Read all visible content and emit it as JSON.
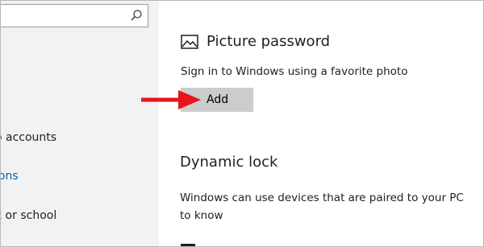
{
  "sidebar": {
    "search": {
      "value": "",
      "placeholder": ""
    },
    "items": [
      {
        "label": "o accounts"
      },
      {
        "label": "ions"
      },
      {
        "label": "k or school"
      }
    ]
  },
  "picture_password": {
    "title": "Picture password",
    "description": "Sign in to Windows using a favorite photo",
    "add_label": "Add"
  },
  "dynamic_lock": {
    "title": "Dynamic lock",
    "description": "Windows can use devices that are paired to your PC to know"
  },
  "colors": {
    "accent": "#0063b1",
    "arrow": "#e8141b",
    "button": "#cccccc"
  },
  "icons": [
    "search-icon",
    "picture-icon",
    "red-arrow-icon"
  ]
}
